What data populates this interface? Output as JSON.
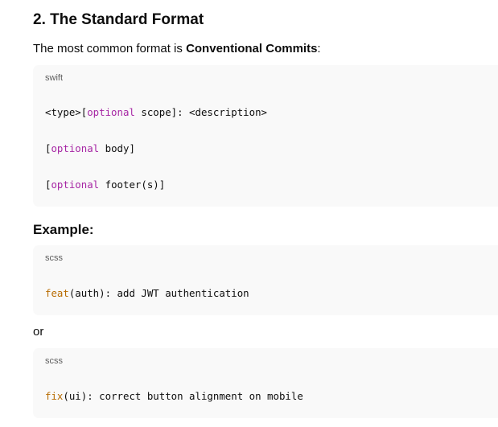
{
  "section": {
    "heading": "2. The Standard Format",
    "intro_prefix": "The most common format is ",
    "intro_bold": "Conventional Commits",
    "intro_suffix": ":"
  },
  "format_block": {
    "language": "swift",
    "line1": {
      "pre": "<type>[",
      "kw": "optional",
      "post": " scope]: <description>"
    },
    "line2": {
      "pre": "[",
      "kw": "optional",
      "post": " body]"
    },
    "line3": {
      "pre": "[",
      "kw": "optional",
      "post": " footer(s)]"
    }
  },
  "example": {
    "heading": "Example:",
    "block1": {
      "language": "scss",
      "fn": "feat",
      "rest": "(auth): add JWT authentication"
    },
    "or_text": "or",
    "block2": {
      "language": "scss",
      "fn": "fix",
      "rest": "(ui): correct button alignment on mobile"
    }
  },
  "colors": {
    "keyword": "#a626a4",
    "function": "#b76b01",
    "code_bg": "#f9f9f9"
  }
}
